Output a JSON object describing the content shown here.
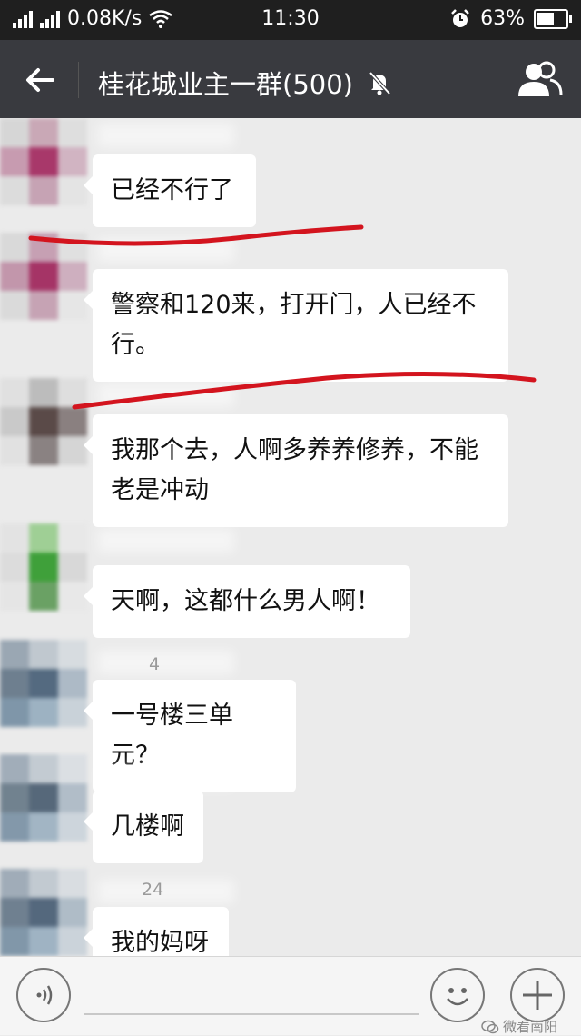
{
  "status_bar": {
    "network_speed": "0.08K/s",
    "time": "11:30",
    "battery_percent": "63%",
    "battery_level": 0.63
  },
  "header": {
    "title": "桂花城业主一群(500)",
    "back_icon": "arrow-left-icon",
    "mute_icon": "bell-off-icon",
    "members_icon": "group-members-icon"
  },
  "messages": [
    {
      "text": "已经不行了",
      "nick_suffix": ""
    },
    {
      "text": "警察和120来，打开门，人已经不行。",
      "nick_suffix": ""
    },
    {
      "text": "我那个去，人啊多养养修养，不能老是冲动",
      "nick_suffix": ""
    },
    {
      "text": "天啊，这都什么男人啊！",
      "nick_suffix": ""
    },
    {
      "text": "一号楼三单元？",
      "nick_suffix": "4"
    },
    {
      "text": "几楼啊",
      "nick_suffix": ""
    },
    {
      "text": "我的妈呀",
      "nick_suffix": "24"
    }
  ],
  "input_bar": {
    "voice_icon": "voice-icon",
    "emoji_icon": "emoji-icon",
    "plus_icon": "plus-icon"
  },
  "watermark": {
    "text": "微看南阳"
  },
  "colors": {
    "header_bg": "#393a3f",
    "status_bg": "#1f1f1f",
    "chat_bg": "#ebebeb",
    "bubble_bg": "#ffffff",
    "annotation_red": "#d3141e"
  }
}
